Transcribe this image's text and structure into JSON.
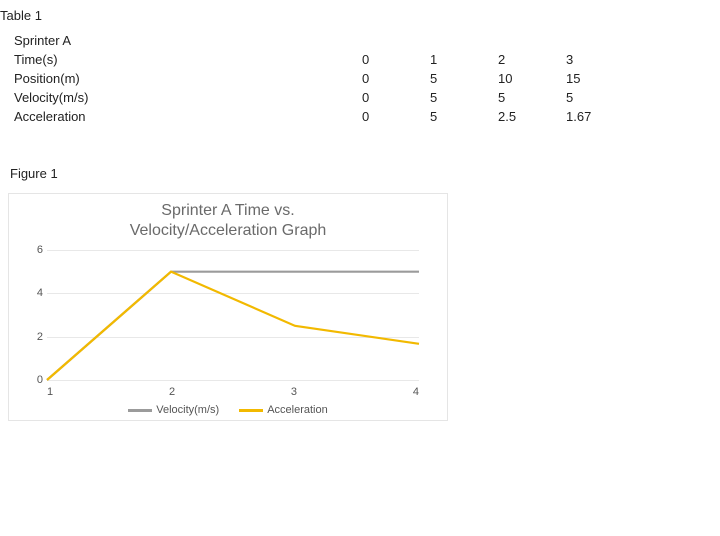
{
  "table": {
    "title": "Table 1",
    "row_header": "Sprinter A",
    "rows": [
      {
        "label": "Time(s)",
        "values": [
          "0",
          "1",
          "2",
          "3"
        ]
      },
      {
        "label": "Position(m)",
        "values": [
          "0",
          "5",
          "10",
          "15"
        ]
      },
      {
        "label": "Velocity(m/s)",
        "values": [
          "0",
          "5",
          "5",
          "5"
        ]
      },
      {
        "label": "Acceleration",
        "values": [
          "0",
          "5",
          "2.5",
          "1.67"
        ]
      }
    ]
  },
  "figure": {
    "label": "Figure 1",
    "title_line1": "Sprinter A Time vs.",
    "title_line2": "Velocity/Acceleration Graph"
  },
  "chart_data": {
    "type": "line",
    "x": [
      1,
      2,
      3,
      4
    ],
    "categories": [
      "1",
      "2",
      "3",
      "4"
    ],
    "series": [
      {
        "name": "Velocity(m/s)",
        "color": "#9b9b9b",
        "values": [
          0,
          5,
          5,
          5
        ]
      },
      {
        "name": "Acceleration",
        "color": "#f2b900",
        "values": [
          0,
          5,
          2.5,
          1.67
        ]
      }
    ],
    "title": "Sprinter A Time vs. Velocity/Acceleration Graph",
    "xlabel": "",
    "ylabel": "",
    "ylim": [
      0,
      6
    ],
    "yticks": [
      0,
      2,
      4,
      6
    ],
    "grid": true,
    "legend_position": "bottom"
  }
}
